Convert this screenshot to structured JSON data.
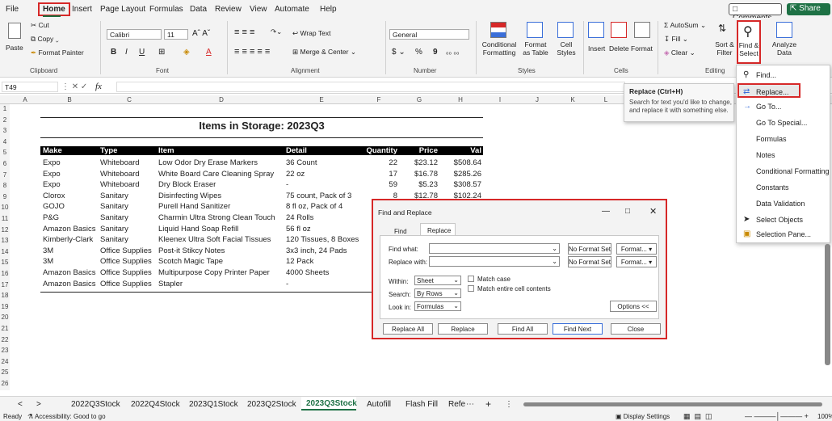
{
  "menu": [
    "File",
    "Home",
    "Insert",
    "Page Layout",
    "Formulas",
    "Data",
    "Review",
    "View",
    "Automate",
    "Help"
  ],
  "comments_label": "Comments",
  "share_label": "Share",
  "ribbon": {
    "clipboard": {
      "paste": "Paste",
      "cut": "Cut",
      "copy": "Copy",
      "format_painter": "Format Painter",
      "label": "Clipboard"
    },
    "font": {
      "name": "Calibri",
      "size": "11",
      "label": "Font"
    },
    "alignment": {
      "wrap": "Wrap Text",
      "merge": "Merge & Center",
      "label": "Alignment"
    },
    "number": {
      "format": "General",
      "label": "Number",
      "currency": "$",
      "percent": "%",
      "comma": "9"
    },
    "styles": {
      "conditional": "Conditional Formatting",
      "format_table": "Format as Table",
      "cell_styles": "Cell Styles",
      "label": "Styles"
    },
    "cells": {
      "insert": "Insert",
      "delete": "Delete",
      "format": "Format",
      "label": "Cells"
    },
    "editing": {
      "autosum": "AutoSum",
      "fill": "Fill",
      "clear": "Clear",
      "sort": "Sort & Filter",
      "find": "Find & Select",
      "label": "Editing"
    },
    "analysis": {
      "analyze": "Analyze Data"
    }
  },
  "namebox": "T49",
  "fx": "fx",
  "columns": [
    "A",
    "B",
    "C",
    "D",
    "E",
    "F",
    "G",
    "H",
    "I",
    "J",
    "K",
    "L"
  ],
  "rows": [
    "1",
    "2",
    "3",
    "4",
    "5",
    "6",
    "7",
    "8",
    "9",
    "10",
    "11",
    "12",
    "13",
    "14",
    "15",
    "16",
    "17",
    "18",
    "19",
    "20",
    "21",
    "22",
    "23",
    "24",
    "25",
    "26"
  ],
  "sheet_title": "Items in Storage: 2023Q3",
  "table_headers": [
    "Make",
    "Type",
    "Item",
    "Detail",
    "Quantity",
    "Price",
    "Val"
  ],
  "table_rows": [
    [
      "Expo",
      "Whiteboard",
      "Low Odor Dry Erase Markers",
      "36 Count",
      "22",
      "$23.12",
      "$508.64"
    ],
    [
      "Expo",
      "Whiteboard",
      "White Board Care Cleaning Spray",
      "22 oz",
      "17",
      "$16.78",
      "$285.26"
    ],
    [
      "Expo",
      "Whiteboard",
      "Dry Block Eraser",
      "-",
      "59",
      "$5.23",
      "$308.57"
    ],
    [
      "Clorox",
      "Sanitary",
      "Disinfecting Wipes",
      "75 count, Pack of 3",
      "8",
      "$12.78",
      "$102.24"
    ],
    [
      "GOJO",
      "Sanitary",
      "Purell Hand Sanitizer",
      "8 fl oz, Pack of 4",
      "",
      "",
      ""
    ],
    [
      "P&G",
      "Sanitary",
      "Charmin Ultra Strong Clean Touch",
      "24 Rolls",
      "",
      "",
      ""
    ],
    [
      "Amazon Basics",
      "Sanitary",
      "Liquid Hand Soap Refill",
      "56 fl oz",
      "",
      "",
      ""
    ],
    [
      "Kimberly-Clark",
      "Sanitary",
      "Kleenex Ultra Soft Facial Tissues",
      "120 Tissues, 8 Boxes",
      "",
      "",
      ""
    ],
    [
      "3M",
      "Office Supplies",
      "Post-it Stikcy Notes",
      "3x3 inch, 24 Pads",
      "",
      "",
      ""
    ],
    [
      "3M",
      "Office Supplies",
      "Scotch Magic Tape",
      "12 Pack",
      "",
      "",
      ""
    ],
    [
      "Amazon Basics",
      "Office Supplies",
      "Multipurpose Copy Printer Paper",
      "4000 Sheets",
      "",
      "",
      ""
    ],
    [
      "Amazon Basics",
      "Office Supplies",
      "Stapler",
      "-",
      "",
      "",
      ""
    ]
  ],
  "tooltip": {
    "title": "Replace (Ctrl+H)",
    "body": "Search for text you'd like to change, and replace it with something else."
  },
  "dropdown": [
    "Find...",
    "Replace...",
    "Go To...",
    "Go To Special...",
    "Formulas",
    "Notes",
    "Conditional Formatting",
    "Constants",
    "Data Validation",
    "Select Objects",
    "Selection Pane..."
  ],
  "dialog": {
    "title": "Find and Replace",
    "tabs": [
      "Find",
      "Replace"
    ],
    "find_what": "Find what:",
    "replace_with": "Replace with:",
    "no_format": "No Format Set",
    "format": "Format...",
    "within_label": "Within:",
    "within": "Sheet",
    "search_label": "Search:",
    "search": "By Rows",
    "lookin_label": "Look in:",
    "lookin": "Formulas",
    "match_case": "Match case",
    "match_entire": "Match entire cell contents",
    "options": "Options <<",
    "buttons": [
      "Replace All",
      "Replace",
      "Find All",
      "Find Next",
      "Close"
    ]
  },
  "sheet_tabs": [
    "2022Q3Stock",
    "2022Q4Stock",
    "2023Q1Stock",
    "2023Q2Stock",
    "2023Q3Stock",
    "Autofill",
    "Flash Fill",
    "Refe"
  ],
  "status": {
    "ready": "Ready",
    "accessibility": "Accessibility: Good to go",
    "display": "Display Settings",
    "zoom": "100%"
  }
}
